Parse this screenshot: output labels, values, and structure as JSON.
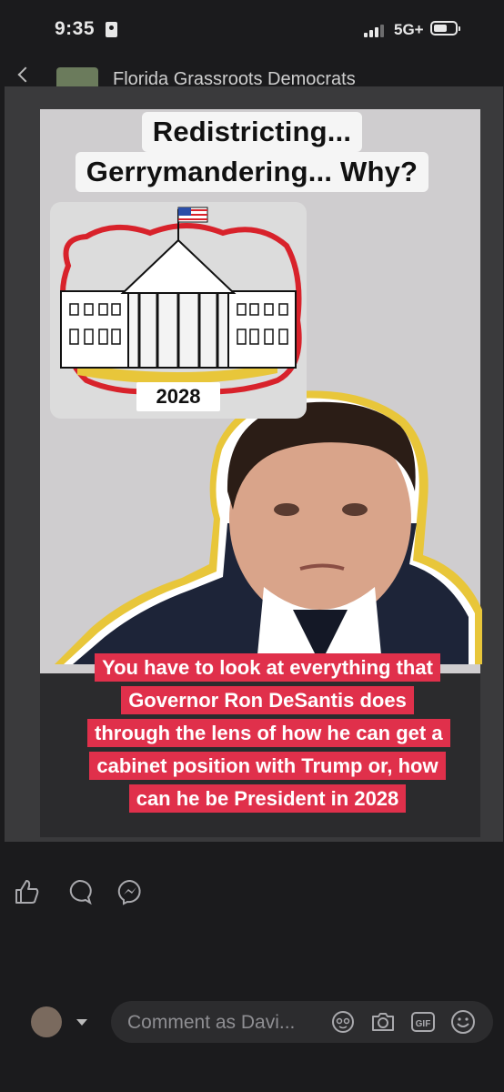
{
  "status_bar": {
    "time": "9:35",
    "network": "5G+"
  },
  "post_header": {
    "group_name": "Florida Grassroots Democrats"
  },
  "image": {
    "headline_line1": "Redistricting...",
    "headline_line2": "Gerrymandering... Why?",
    "sticker_year": "2028",
    "caption": "You have to look at everything that Governor Ron DeSantis does through the lens of how he can get a cabinet position with Trump or, how can he be President in 2028"
  },
  "actions": {
    "like_icon": "thumbs-up-icon",
    "comment_icon": "comment-bubble-icon",
    "messenger_icon": "messenger-icon"
  },
  "comment_bar": {
    "placeholder": "Comment as Davi...",
    "icons": [
      "avatar-sticker-icon",
      "camera-icon",
      "gif-icon",
      "emoji-icon"
    ]
  },
  "colors": {
    "caption_bg": "#e0304b",
    "background": "#1b1b1d",
    "sticker_outline": "#d8222b",
    "sticker_ground": "#e8c63a"
  }
}
